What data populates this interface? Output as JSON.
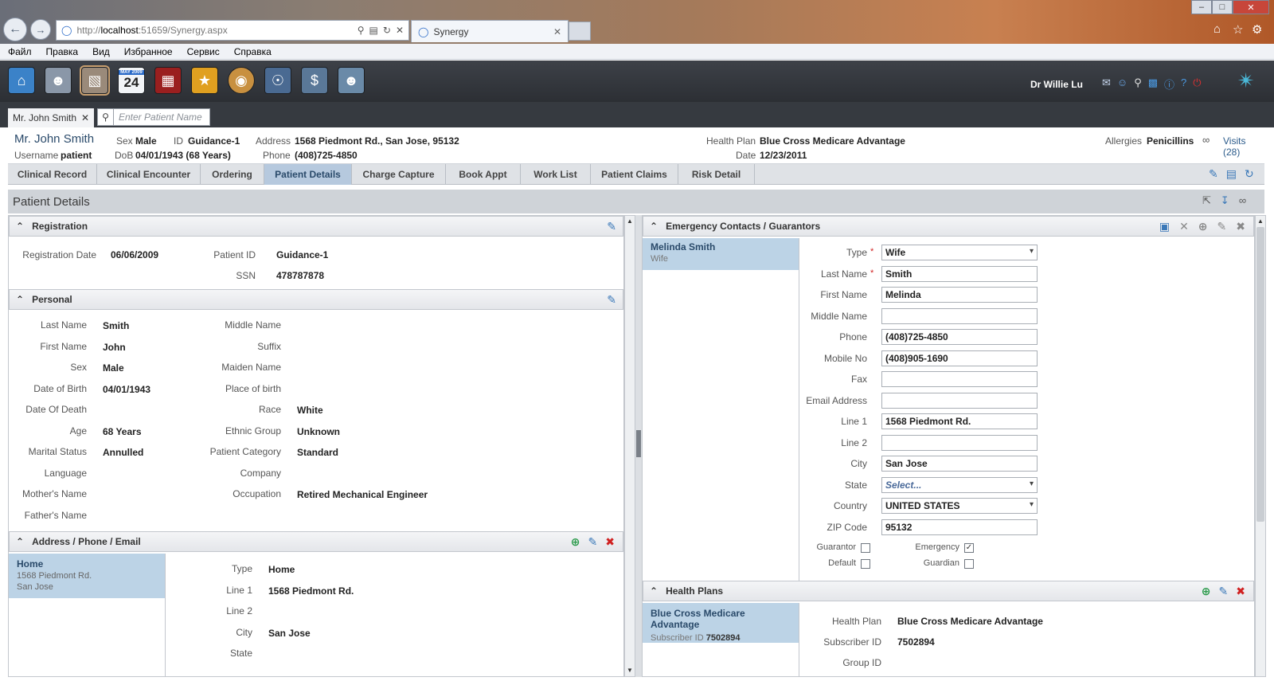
{
  "browser": {
    "url_prefix": "http://",
    "url_host": "localhost",
    "url_rest": ":51659/Synergy.aspx",
    "tab_title": "Synergy"
  },
  "menu": [
    "Файл",
    "Правка",
    "Вид",
    "Избранное",
    "Сервис",
    "Справка"
  ],
  "toolbar": {
    "calendar_day": "24",
    "calendar_month": "MAY 2009",
    "user": "Dr Willie Lu"
  },
  "patient_tab": {
    "label": "Mr. John Smith",
    "search_placeholder": "Enter Patient Name"
  },
  "banner": {
    "name": "Mr. John Smith",
    "username_label": "Username",
    "username": "patient",
    "sex_label": "Sex",
    "sex": "Male",
    "dob_label": "DoB",
    "dob": "04/01/1943 (68 Years)",
    "id_label": "ID",
    "id": "Guidance-1",
    "address_label": "Address",
    "address": "1568 Piedmont Rd., San Jose, 95132",
    "phone_label": "Phone",
    "phone": "(408)725-4850",
    "plan_label": "Health Plan",
    "plan": "Blue Cross Medicare Advantage",
    "date_label": "Date",
    "date": "12/23/2011",
    "allergies_label": "Allergies",
    "allergies": "Penicillins",
    "visits": "Visits (28)"
  },
  "nav": [
    "Clinical Record",
    "Clinical Encounter",
    "Ordering",
    "Patient Details",
    "Charge Capture",
    "Book Appt",
    "Work List",
    "Patient Claims",
    "Risk Detail"
  ],
  "page_title": "Patient Details",
  "registration": {
    "title": "Registration",
    "date_label": "Registration Date",
    "date": "06/06/2009",
    "pid_label": "Patient ID",
    "pid": "Guidance-1",
    "ssn_label": "SSN",
    "ssn": "478787878"
  },
  "personal": {
    "title": "Personal",
    "left": [
      {
        "l": "Last Name",
        "v": "Smith"
      },
      {
        "l": "First Name",
        "v": "John"
      },
      {
        "l": "Sex",
        "v": "Male"
      },
      {
        "l": "Date of Birth",
        "v": "04/01/1943"
      },
      {
        "l": "Date Of Death",
        "v": ""
      },
      {
        "l": "Age",
        "v": "68 Years"
      },
      {
        "l": "Marital Status",
        "v": "Annulled"
      },
      {
        "l": "Language",
        "v": ""
      },
      {
        "l": "Mother's Name",
        "v": ""
      },
      {
        "l": "Father's Name",
        "v": ""
      }
    ],
    "right": [
      {
        "l": "Middle Name",
        "v": ""
      },
      {
        "l": "Suffix",
        "v": ""
      },
      {
        "l": "Maiden Name",
        "v": ""
      },
      {
        "l": "Place of birth",
        "v": ""
      },
      {
        "l": "Race",
        "v": "White"
      },
      {
        "l": "Ethnic Group",
        "v": "Unknown"
      },
      {
        "l": "Patient Category",
        "v": "Standard"
      },
      {
        "l": "Company",
        "v": ""
      },
      {
        "l": "Occupation",
        "v": "Retired Mechanical Engineer"
      }
    ]
  },
  "address": {
    "title": "Address / Phone / Email",
    "item_title": "Home",
    "item_line1": "1568 Piedmont Rd.",
    "item_line2": "San Jose",
    "fields": [
      {
        "l": "Type",
        "v": "Home"
      },
      {
        "l": "Line 1",
        "v": "1568 Piedmont Rd."
      },
      {
        "l": "Line 2",
        "v": ""
      },
      {
        "l": "City",
        "v": "San Jose"
      },
      {
        "l": "State",
        "v": ""
      }
    ]
  },
  "emergency": {
    "title": "Emergency Contacts / Guarantors",
    "item_name": "Melinda Smith",
    "item_rel": "Wife",
    "fields": [
      {
        "l": "Type",
        "v": "Wife",
        "req": true,
        "dd": true
      },
      {
        "l": "Last Name",
        "v": "Smith",
        "req": true
      },
      {
        "l": "First Name",
        "v": "Melinda"
      },
      {
        "l": "Middle Name",
        "v": ""
      },
      {
        "l": "Phone",
        "v": "(408)725-4850"
      },
      {
        "l": "Mobile No",
        "v": "(408)905-1690"
      },
      {
        "l": "Fax",
        "v": ""
      },
      {
        "l": "Email Address",
        "v": ""
      },
      {
        "l": "Line 1",
        "v": "1568 Piedmont Rd."
      },
      {
        "l": "Line 2",
        "v": ""
      },
      {
        "l": "City",
        "v": "San Jose"
      },
      {
        "l": "State",
        "v": "Select...",
        "dd": true,
        "placeholder": true
      },
      {
        "l": "Country",
        "v": "UNITED STATES",
        "dd": true
      },
      {
        "l": "ZIP Code",
        "v": "95132"
      }
    ],
    "checks": [
      {
        "l": "Guarantor",
        "checked": false
      },
      {
        "l": "Emergency",
        "checked": true
      },
      {
        "l": "Default",
        "checked": false
      },
      {
        "l": "Guardian",
        "checked": false
      }
    ]
  },
  "health_plans": {
    "title": "Health Plans",
    "item_name": "Blue Cross Medicare Advantage",
    "item_sub_label": "Subscriber ID",
    "item_sub": "7502894",
    "plan_label": "Health Plan",
    "plan": "Blue Cross Medicare Advantage",
    "sub_label": "Subscriber ID",
    "sub": "7502894",
    "group_label": "Group ID"
  }
}
